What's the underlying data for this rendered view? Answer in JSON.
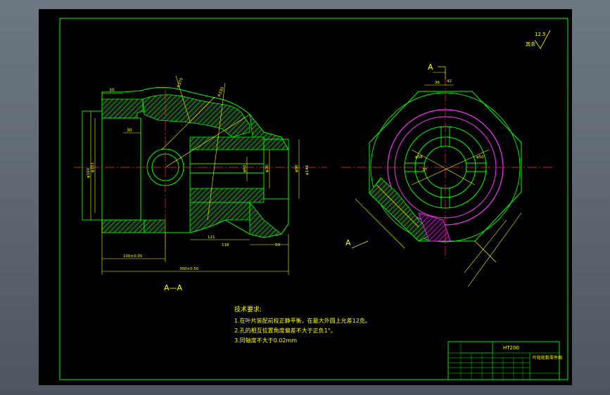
{
  "drawing": {
    "section_label": "A—A",
    "view_marker": "A",
    "view_marker_2": "A",
    "roughness_value": "12.5",
    "roughness_note": "其余",
    "notes_title": "技术要求:",
    "notes": [
      "1.在叶片装配前校正静平衡，在最大外圆上允差12克。",
      "2.孔的相互位置角度偏差不大于正负1°。",
      "3.同轴度不大于0.02mm"
    ],
    "dims": {
      "d30a": "30",
      "d30b": "30",
      "d100": "100±0.05",
      "d121": "121",
      "d118": "118",
      "d50": "50",
      "d360": "360±0.50",
      "phi160": "φ160",
      "phi151": "φ151",
      "phi60": "φ60",
      "phi30": "φ30",
      "phi90": "φ90",
      "phi146": "φ146",
      "r370": "R370",
      "r330": "R330",
      "d42": "42",
      "d36": "36",
      "phi58": "φ58",
      "phi50": "φ50",
      "d37": "37"
    },
    "title_block": {
      "material": "HT200",
      "part_name": "叶轮轮毂零件图"
    }
  }
}
